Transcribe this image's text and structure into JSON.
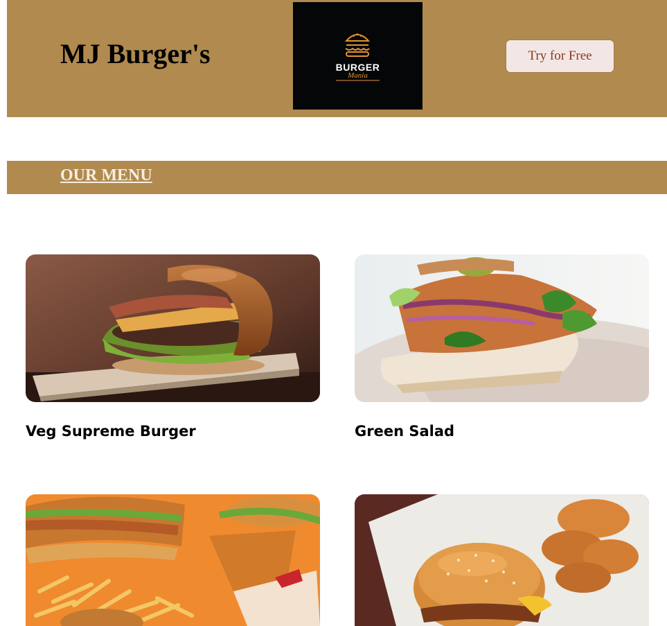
{
  "header": {
    "title": "MJ Burger's",
    "logo": {
      "word": "BURGER",
      "script": "Mania",
      "icon": "burger-icon"
    },
    "cta_label": "Try for Free"
  },
  "menu": {
    "heading": "OUR MENU",
    "items": [
      {
        "name": "Veg Supreme Burger"
      },
      {
        "name": "Green Salad"
      },
      {
        "name": ""
      },
      {
        "name": ""
      }
    ]
  },
  "colors": {
    "brand": "#b08a4f",
    "button_bg": "#f3e7e6",
    "button_text": "#8a3a1c",
    "logo_accent": "#e39434"
  }
}
